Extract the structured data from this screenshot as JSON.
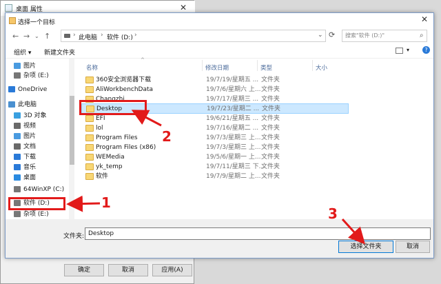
{
  "bg_window": {
    "title": "桌面 属性",
    "ok": "确定",
    "cancel": "取消",
    "apply": "应用(A)"
  },
  "dialog": {
    "title": "选择一个目标",
    "breadcrumb": [
      "此电脑",
      "软件 (D:)"
    ],
    "search_placeholder": "搜索\"软件 (D:)\"",
    "organize": "组织 ▾",
    "new_folder": "新建文件夹",
    "columns": {
      "name": "名称",
      "date": "修改日期",
      "type": "类型",
      "size": "大小"
    },
    "nav": [
      {
        "label": "图片",
        "color": "#4a9be0"
      },
      {
        "label": "杂项 (E:)",
        "color": "#777777"
      },
      {
        "label": "OneDrive",
        "color": "#2a7ad8"
      },
      {
        "label": "此电脑",
        "color": "#4a90d0"
      },
      {
        "label": "3D 对象",
        "color": "#3aa0e0"
      },
      {
        "label": "视频",
        "color": "#6a6a6a"
      },
      {
        "label": "图片",
        "color": "#4a9be0"
      },
      {
        "label": "文档",
        "color": "#6a6a6a"
      },
      {
        "label": "下载",
        "color": "#2a7ad8"
      },
      {
        "label": "音乐",
        "color": "#2a7ad8"
      },
      {
        "label": "桌面",
        "color": "#2a8ae0"
      },
      {
        "label": "64WinXP (C:)",
        "color": "#777777"
      },
      {
        "label": "软件 (D:)",
        "color": "#777777"
      },
      {
        "label": "杂项 (E:)",
        "color": "#777777"
      }
    ],
    "files": [
      {
        "name": "360安全浏览器下载",
        "date": "19/7/19/星期五 ...",
        "type": "文件夹"
      },
      {
        "name": "AliWorkbenchData",
        "date": "19/7/6/星期六 上...",
        "type": "文件夹"
      },
      {
        "name": "Changzhi",
        "date": "19/7/17/星期三 ...",
        "type": "文件夹"
      },
      {
        "name": "Desktop",
        "date": "19/7/23/星期二 ...",
        "type": "文件夹"
      },
      {
        "name": "EFI",
        "date": "19/6/21/星期五 ...",
        "type": "文件夹"
      },
      {
        "name": "lol",
        "date": "19/7/16/星期二 ...",
        "type": "文件夹"
      },
      {
        "name": "Program Files",
        "date": "19/7/3/星期三 上...",
        "type": "文件夹"
      },
      {
        "name": "Program Files (x86)",
        "date": "19/7/3/星期三 上...",
        "type": "文件夹"
      },
      {
        "name": "WEMedia",
        "date": "19/5/6/星期一 上...",
        "type": "文件夹"
      },
      {
        "name": "yk_temp",
        "date": "19/7/11/星期三 下...",
        "type": "文件夹"
      },
      {
        "name": "软件",
        "date": "19/7/9/星期二 上...",
        "type": "文件夹"
      }
    ],
    "filename_label": "文件夹:",
    "filename_value": "Desktop",
    "select_button": "选择文件夹",
    "cancel_button": "取消"
  },
  "annotations": {
    "step1": "1",
    "step2": "2",
    "step3": "3",
    "color": "#e21a1a"
  }
}
